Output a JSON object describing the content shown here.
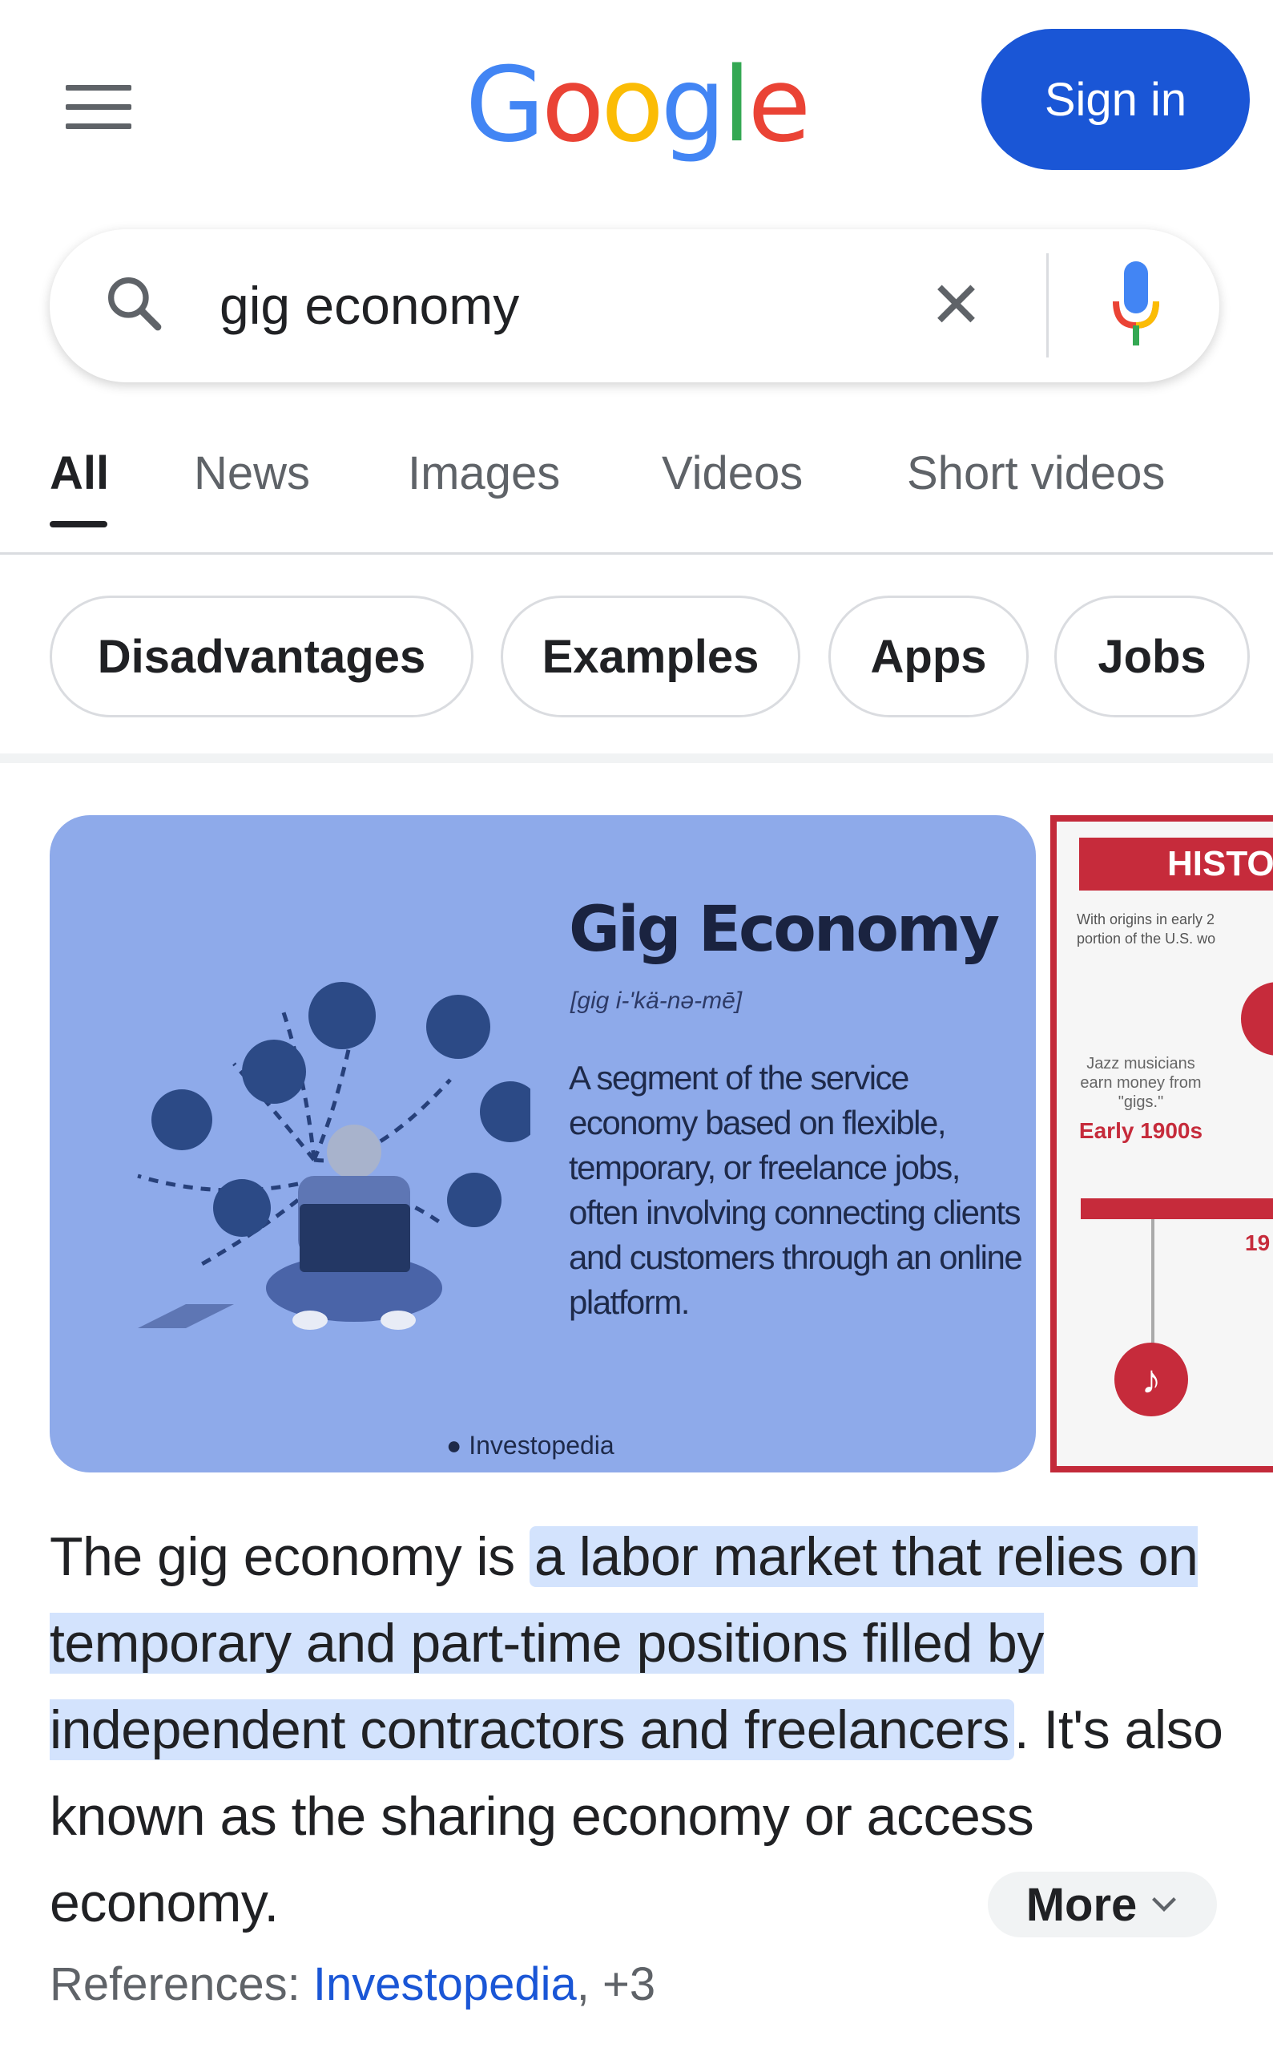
{
  "header": {
    "logo": "Google",
    "logo_colors": [
      "#4285F4",
      "#EA4335",
      "#FBBC05",
      "#4285F4",
      "#34A853",
      "#EA4335"
    ],
    "signin_label": "Sign in",
    "accent": "#1a56d6"
  },
  "search": {
    "query": "gig economy",
    "icons": [
      "search-icon",
      "close-icon",
      "microphone-icon"
    ]
  },
  "tabs": [
    {
      "label": "All",
      "active": true
    },
    {
      "label": "News"
    },
    {
      "label": "Images"
    },
    {
      "label": "Videos"
    },
    {
      "label": "Short videos"
    }
  ],
  "chips": [
    "Disadvantages",
    "Examples",
    "Apps",
    "Jobs"
  ],
  "images": {
    "first": {
      "title": "Gig Economy",
      "pronunciation": "[gig i-'kä-nə-mē]",
      "definition": "A segment of the service economy based on flexible, temporary, or freelance jobs, often involving connecting clients and customers through an online platform.",
      "source": "Investopedia"
    },
    "second": {
      "heading": "HISTO",
      "subtitle_1": "With origins in early 2",
      "subtitle_2": "portion of the U.S. wo",
      "caption": "Jazz musicians earn money from \"gigs.\"",
      "era": "Early 1900s",
      "year_partial": "19"
    }
  },
  "answer": {
    "before": "The gig economy is ",
    "highlight": "a labor market that relies on temporary and part-time positions filled by independent contractors and freelancers",
    "after": ". It's also known as the sharing economy or access economy.",
    "more_label": "More",
    "references_label": "References: ",
    "reference_link": "Investopedia",
    "reference_extra": ", +3"
  }
}
